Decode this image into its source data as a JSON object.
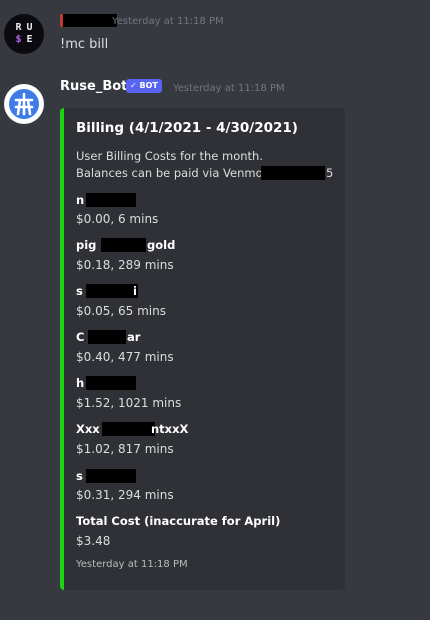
{
  "message1": {
    "timestamp": "Yesterday at 11:18 PM",
    "content": "!mc bill"
  },
  "avatar1": {
    "glyphs": [
      "R",
      "U",
      "$",
      "E"
    ]
  },
  "message2": {
    "author": "Ruse_Bot",
    "badge": "✓ BOT",
    "timestamp": "Yesterday at 11:18 PM"
  },
  "embed": {
    "accent_color": "#1ed30f",
    "title": "Billing (4/1/2021 - 4/30/2021)",
    "description_line1": "User Billing Costs for the month.",
    "description_line2": "Balances can be paid via Venmo: @",
    "description_tail": "5",
    "fields": [
      {
        "name": "n",
        "value": "$0.00, 6 mins"
      },
      {
        "name_left": "pig",
        "name_right": "gold",
        "value": "$0.18, 289 mins"
      },
      {
        "name": "s",
        "name_right": "i",
        "value": "$0.05, 65 mins"
      },
      {
        "name": "C",
        "name_right": "ar",
        "value": "$0.40, 477 mins"
      },
      {
        "name": "h",
        "value": "$1.52, 1021 mins"
      },
      {
        "name_left": "Xxx",
        "name_right": "ntxxX",
        "value": "$1.02, 817 mins"
      },
      {
        "name": "s",
        "value": "$0.31, 294 mins"
      }
    ],
    "total_name": "Total Cost (inaccurate for April)",
    "total_value": "$3.48",
    "footer": "Yesterday at 11:18 PM"
  }
}
